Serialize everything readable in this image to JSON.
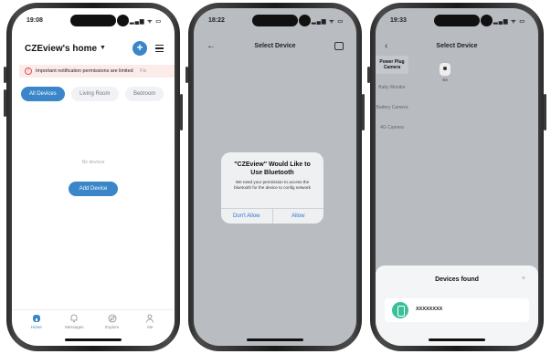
{
  "colors": {
    "accent": "#3a86c8",
    "alert_button": "#2a74d4",
    "warning": "#e05050",
    "device_icon": "#3bbf9a"
  },
  "screen1": {
    "status_time": "19:08",
    "home_title": "CZEview's home",
    "caret_icon": "caret-down-icon",
    "add_icon": "plus-icon",
    "menu_icon": "menu-icon",
    "notice": "Important notification permissions are limited",
    "notice_more": "Fix",
    "tabs": [
      "All Devices",
      "Living Room",
      "Bedroom"
    ],
    "empty_text": "No devices",
    "add_device": "Add Device",
    "nav": [
      {
        "label": "Home",
        "icon": "home-icon"
      },
      {
        "label": "Messages",
        "icon": "bell-icon"
      },
      {
        "label": "Explore",
        "icon": "compass-icon"
      },
      {
        "label": "Me",
        "icon": "person-icon"
      }
    ]
  },
  "screen2": {
    "status_time": "18:22",
    "title": "Select Device",
    "alert": {
      "title": "\"CZEview\" Would Like to Use Bluetooth",
      "message": "We need your permission to access the bluetooth for the device to config network",
      "deny": "Don't Allow",
      "allow": "Allow"
    }
  },
  "screen3": {
    "status_time": "19:33",
    "title": "Select Device",
    "categories": [
      "Power Plug Camera",
      "Baby Monitor",
      "Battery Camera",
      "4G Camera"
    ],
    "device_label": "S4",
    "sheet_title": "Devices found",
    "sheet_close": "×",
    "found_device": "XXXXXXXX"
  }
}
